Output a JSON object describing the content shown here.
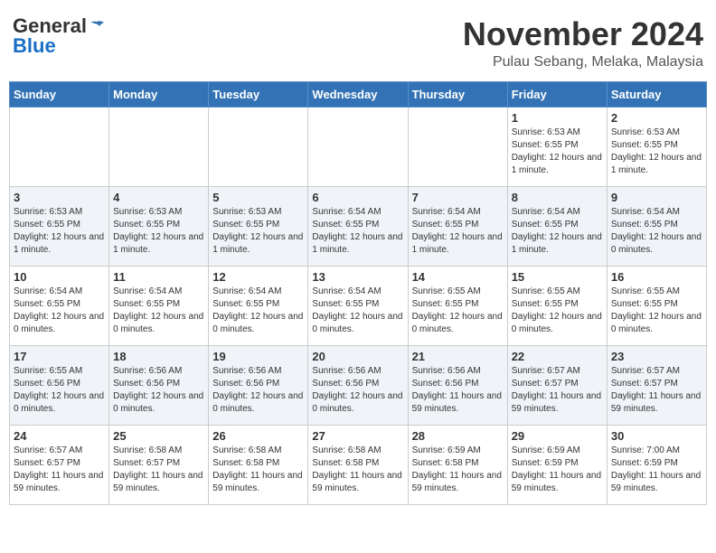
{
  "header": {
    "logo_general": "General",
    "logo_blue": "Blue",
    "month_title": "November 2024",
    "location": "Pulau Sebang, Melaka, Malaysia"
  },
  "weekdays": [
    "Sunday",
    "Monday",
    "Tuesday",
    "Wednesday",
    "Thursday",
    "Friday",
    "Saturday"
  ],
  "weeks": [
    [
      {
        "day": "",
        "info": ""
      },
      {
        "day": "",
        "info": ""
      },
      {
        "day": "",
        "info": ""
      },
      {
        "day": "",
        "info": ""
      },
      {
        "day": "",
        "info": ""
      },
      {
        "day": "1",
        "info": "Sunrise: 6:53 AM\nSunset: 6:55 PM\nDaylight: 12 hours and 1 minute."
      },
      {
        "day": "2",
        "info": "Sunrise: 6:53 AM\nSunset: 6:55 PM\nDaylight: 12 hours and 1 minute."
      }
    ],
    [
      {
        "day": "3",
        "info": "Sunrise: 6:53 AM\nSunset: 6:55 PM\nDaylight: 12 hours and 1 minute."
      },
      {
        "day": "4",
        "info": "Sunrise: 6:53 AM\nSunset: 6:55 PM\nDaylight: 12 hours and 1 minute."
      },
      {
        "day": "5",
        "info": "Sunrise: 6:53 AM\nSunset: 6:55 PM\nDaylight: 12 hours and 1 minute."
      },
      {
        "day": "6",
        "info": "Sunrise: 6:54 AM\nSunset: 6:55 PM\nDaylight: 12 hours and 1 minute."
      },
      {
        "day": "7",
        "info": "Sunrise: 6:54 AM\nSunset: 6:55 PM\nDaylight: 12 hours and 1 minute."
      },
      {
        "day": "8",
        "info": "Sunrise: 6:54 AM\nSunset: 6:55 PM\nDaylight: 12 hours and 1 minute."
      },
      {
        "day": "9",
        "info": "Sunrise: 6:54 AM\nSunset: 6:55 PM\nDaylight: 12 hours and 0 minutes."
      }
    ],
    [
      {
        "day": "10",
        "info": "Sunrise: 6:54 AM\nSunset: 6:55 PM\nDaylight: 12 hours and 0 minutes."
      },
      {
        "day": "11",
        "info": "Sunrise: 6:54 AM\nSunset: 6:55 PM\nDaylight: 12 hours and 0 minutes."
      },
      {
        "day": "12",
        "info": "Sunrise: 6:54 AM\nSunset: 6:55 PM\nDaylight: 12 hours and 0 minutes."
      },
      {
        "day": "13",
        "info": "Sunrise: 6:54 AM\nSunset: 6:55 PM\nDaylight: 12 hours and 0 minutes."
      },
      {
        "day": "14",
        "info": "Sunrise: 6:55 AM\nSunset: 6:55 PM\nDaylight: 12 hours and 0 minutes."
      },
      {
        "day": "15",
        "info": "Sunrise: 6:55 AM\nSunset: 6:55 PM\nDaylight: 12 hours and 0 minutes."
      },
      {
        "day": "16",
        "info": "Sunrise: 6:55 AM\nSunset: 6:55 PM\nDaylight: 12 hours and 0 minutes."
      }
    ],
    [
      {
        "day": "17",
        "info": "Sunrise: 6:55 AM\nSunset: 6:56 PM\nDaylight: 12 hours and 0 minutes."
      },
      {
        "day": "18",
        "info": "Sunrise: 6:56 AM\nSunset: 6:56 PM\nDaylight: 12 hours and 0 minutes."
      },
      {
        "day": "19",
        "info": "Sunrise: 6:56 AM\nSunset: 6:56 PM\nDaylight: 12 hours and 0 minutes."
      },
      {
        "day": "20",
        "info": "Sunrise: 6:56 AM\nSunset: 6:56 PM\nDaylight: 12 hours and 0 minutes."
      },
      {
        "day": "21",
        "info": "Sunrise: 6:56 AM\nSunset: 6:56 PM\nDaylight: 11 hours and 59 minutes."
      },
      {
        "day": "22",
        "info": "Sunrise: 6:57 AM\nSunset: 6:57 PM\nDaylight: 11 hours and 59 minutes."
      },
      {
        "day": "23",
        "info": "Sunrise: 6:57 AM\nSunset: 6:57 PM\nDaylight: 11 hours and 59 minutes."
      }
    ],
    [
      {
        "day": "24",
        "info": "Sunrise: 6:57 AM\nSunset: 6:57 PM\nDaylight: 11 hours and 59 minutes."
      },
      {
        "day": "25",
        "info": "Sunrise: 6:58 AM\nSunset: 6:57 PM\nDaylight: 11 hours and 59 minutes."
      },
      {
        "day": "26",
        "info": "Sunrise: 6:58 AM\nSunset: 6:58 PM\nDaylight: 11 hours and 59 minutes."
      },
      {
        "day": "27",
        "info": "Sunrise: 6:58 AM\nSunset: 6:58 PM\nDaylight: 11 hours and 59 minutes."
      },
      {
        "day": "28",
        "info": "Sunrise: 6:59 AM\nSunset: 6:58 PM\nDaylight: 11 hours and 59 minutes."
      },
      {
        "day": "29",
        "info": "Sunrise: 6:59 AM\nSunset: 6:59 PM\nDaylight: 11 hours and 59 minutes."
      },
      {
        "day": "30",
        "info": "Sunrise: 7:00 AM\nSunset: 6:59 PM\nDaylight: 11 hours and 59 minutes."
      }
    ]
  ]
}
